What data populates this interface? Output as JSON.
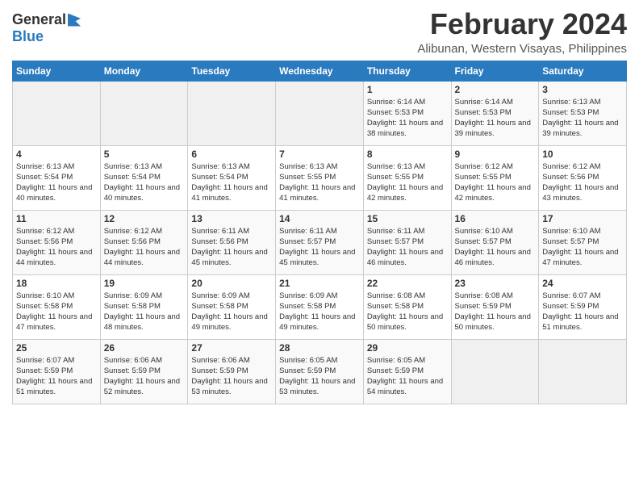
{
  "app": {
    "name_general": "General",
    "name_blue": "Blue"
  },
  "header": {
    "month": "February 2024",
    "location": "Alibunan, Western Visayas, Philippines"
  },
  "columns": [
    "Sunday",
    "Monday",
    "Tuesday",
    "Wednesday",
    "Thursday",
    "Friday",
    "Saturday"
  ],
  "weeks": [
    [
      {
        "day": "",
        "sunrise": "",
        "sunset": "",
        "daylight": "",
        "empty": true
      },
      {
        "day": "",
        "sunrise": "",
        "sunset": "",
        "daylight": "",
        "empty": true
      },
      {
        "day": "",
        "sunrise": "",
        "sunset": "",
        "daylight": "",
        "empty": true
      },
      {
        "day": "",
        "sunrise": "",
        "sunset": "",
        "daylight": "",
        "empty": true
      },
      {
        "day": "1",
        "sunrise": "Sunrise: 6:14 AM",
        "sunset": "Sunset: 5:53 PM",
        "daylight": "Daylight: 11 hours and 38 minutes."
      },
      {
        "day": "2",
        "sunrise": "Sunrise: 6:14 AM",
        "sunset": "Sunset: 5:53 PM",
        "daylight": "Daylight: 11 hours and 39 minutes."
      },
      {
        "day": "3",
        "sunrise": "Sunrise: 6:13 AM",
        "sunset": "Sunset: 5:53 PM",
        "daylight": "Daylight: 11 hours and 39 minutes."
      }
    ],
    [
      {
        "day": "4",
        "sunrise": "Sunrise: 6:13 AM",
        "sunset": "Sunset: 5:54 PM",
        "daylight": "Daylight: 11 hours and 40 minutes."
      },
      {
        "day": "5",
        "sunrise": "Sunrise: 6:13 AM",
        "sunset": "Sunset: 5:54 PM",
        "daylight": "Daylight: 11 hours and 40 minutes."
      },
      {
        "day": "6",
        "sunrise": "Sunrise: 6:13 AM",
        "sunset": "Sunset: 5:54 PM",
        "daylight": "Daylight: 11 hours and 41 minutes."
      },
      {
        "day": "7",
        "sunrise": "Sunrise: 6:13 AM",
        "sunset": "Sunset: 5:55 PM",
        "daylight": "Daylight: 11 hours and 41 minutes."
      },
      {
        "day": "8",
        "sunrise": "Sunrise: 6:13 AM",
        "sunset": "Sunset: 5:55 PM",
        "daylight": "Daylight: 11 hours and 42 minutes."
      },
      {
        "day": "9",
        "sunrise": "Sunrise: 6:12 AM",
        "sunset": "Sunset: 5:55 PM",
        "daylight": "Daylight: 11 hours and 42 minutes."
      },
      {
        "day": "10",
        "sunrise": "Sunrise: 6:12 AM",
        "sunset": "Sunset: 5:56 PM",
        "daylight": "Daylight: 11 hours and 43 minutes."
      }
    ],
    [
      {
        "day": "11",
        "sunrise": "Sunrise: 6:12 AM",
        "sunset": "Sunset: 5:56 PM",
        "daylight": "Daylight: 11 hours and 44 minutes."
      },
      {
        "day": "12",
        "sunrise": "Sunrise: 6:12 AM",
        "sunset": "Sunset: 5:56 PM",
        "daylight": "Daylight: 11 hours and 44 minutes."
      },
      {
        "day": "13",
        "sunrise": "Sunrise: 6:11 AM",
        "sunset": "Sunset: 5:56 PM",
        "daylight": "Daylight: 11 hours and 45 minutes."
      },
      {
        "day": "14",
        "sunrise": "Sunrise: 6:11 AM",
        "sunset": "Sunset: 5:57 PM",
        "daylight": "Daylight: 11 hours and 45 minutes."
      },
      {
        "day": "15",
        "sunrise": "Sunrise: 6:11 AM",
        "sunset": "Sunset: 5:57 PM",
        "daylight": "Daylight: 11 hours and 46 minutes."
      },
      {
        "day": "16",
        "sunrise": "Sunrise: 6:10 AM",
        "sunset": "Sunset: 5:57 PM",
        "daylight": "Daylight: 11 hours and 46 minutes."
      },
      {
        "day": "17",
        "sunrise": "Sunrise: 6:10 AM",
        "sunset": "Sunset: 5:57 PM",
        "daylight": "Daylight: 11 hours and 47 minutes."
      }
    ],
    [
      {
        "day": "18",
        "sunrise": "Sunrise: 6:10 AM",
        "sunset": "Sunset: 5:58 PM",
        "daylight": "Daylight: 11 hours and 47 minutes."
      },
      {
        "day": "19",
        "sunrise": "Sunrise: 6:09 AM",
        "sunset": "Sunset: 5:58 PM",
        "daylight": "Daylight: 11 hours and 48 minutes."
      },
      {
        "day": "20",
        "sunrise": "Sunrise: 6:09 AM",
        "sunset": "Sunset: 5:58 PM",
        "daylight": "Daylight: 11 hours and 49 minutes."
      },
      {
        "day": "21",
        "sunrise": "Sunrise: 6:09 AM",
        "sunset": "Sunset: 5:58 PM",
        "daylight": "Daylight: 11 hours and 49 minutes."
      },
      {
        "day": "22",
        "sunrise": "Sunrise: 6:08 AM",
        "sunset": "Sunset: 5:58 PM",
        "daylight": "Daylight: 11 hours and 50 minutes."
      },
      {
        "day": "23",
        "sunrise": "Sunrise: 6:08 AM",
        "sunset": "Sunset: 5:59 PM",
        "daylight": "Daylight: 11 hours and 50 minutes."
      },
      {
        "day": "24",
        "sunrise": "Sunrise: 6:07 AM",
        "sunset": "Sunset: 5:59 PM",
        "daylight": "Daylight: 11 hours and 51 minutes."
      }
    ],
    [
      {
        "day": "25",
        "sunrise": "Sunrise: 6:07 AM",
        "sunset": "Sunset: 5:59 PM",
        "daylight": "Daylight: 11 hours and 51 minutes."
      },
      {
        "day": "26",
        "sunrise": "Sunrise: 6:06 AM",
        "sunset": "Sunset: 5:59 PM",
        "daylight": "Daylight: 11 hours and 52 minutes."
      },
      {
        "day": "27",
        "sunrise": "Sunrise: 6:06 AM",
        "sunset": "Sunset: 5:59 PM",
        "daylight": "Daylight: 11 hours and 53 minutes."
      },
      {
        "day": "28",
        "sunrise": "Sunrise: 6:05 AM",
        "sunset": "Sunset: 5:59 PM",
        "daylight": "Daylight: 11 hours and 53 minutes."
      },
      {
        "day": "29",
        "sunrise": "Sunrise: 6:05 AM",
        "sunset": "Sunset: 5:59 PM",
        "daylight": "Daylight: 11 hours and 54 minutes."
      },
      {
        "day": "",
        "sunrise": "",
        "sunset": "",
        "daylight": "",
        "empty": true
      },
      {
        "day": "",
        "sunrise": "",
        "sunset": "",
        "daylight": "",
        "empty": true
      }
    ]
  ]
}
